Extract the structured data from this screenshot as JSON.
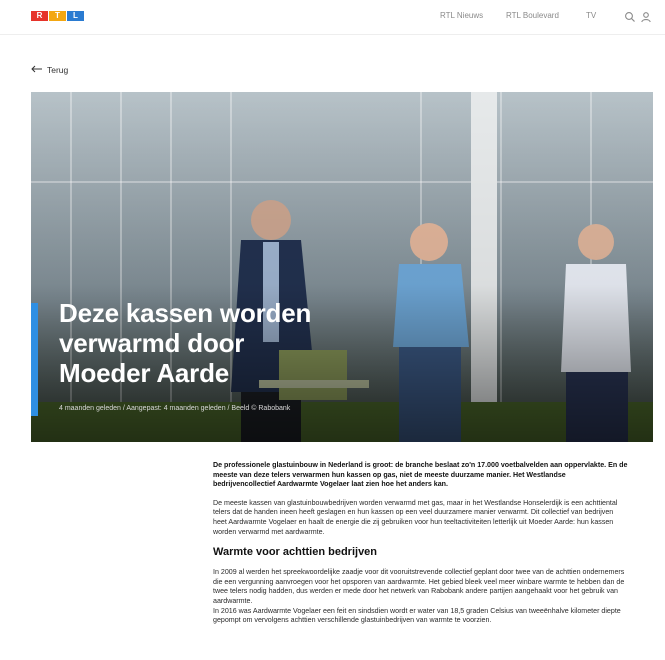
{
  "header": {
    "logo": [
      "R",
      "T",
      "L"
    ],
    "nav": [
      "RTL Nieuws",
      "RTL Boulevard",
      "TV"
    ],
    "search_icon": "search-icon",
    "user_icon": "user-icon",
    "colors": {
      "logo_red": "#e6332a",
      "logo_yellow": "#f3a712",
      "logo_blue": "#2a7bd1"
    }
  },
  "back": {
    "label": "Terug",
    "icon": "arrow-left-icon"
  },
  "hero": {
    "title_lines": [
      "Deze kassen worden",
      "verwarmd door",
      "Moeder Aarde"
    ],
    "meta": "4 maanden geleden / Aangepast: 4 maanden geleden / Beeld © Rabobank",
    "accent_color": "#2f8fe3"
  },
  "article": {
    "lead": "De professionele glastuinbouw in Nederland is groot: de branche beslaat zo'n 17.000 voetbalvelden aan oppervlakte. En de meeste van deze telers verwarmen hun kassen op gas, niet de meeste duurzame manier. Het Westlandse bedrijvencollectief Aardwarmte Vogelaer laat zien hoe het anders kan.",
    "p1": "De meeste kassen van glastuinbouwbedrijven worden verwarmd met gas, maar in het Westlandse Honselerdijk is een achttiental telers dat de handen ineen heeft geslagen en hun kassen op een veel duurzamere manier verwarmt. Dit collectief van bedrijven heet Aardwarmte Vogelaer en haalt de energie die zij gebruiken voor hun teeltactiviteiten letterlijk uit Moeder Aarde: hun kassen worden verwarmd met aardwarmte.",
    "heading": "Warmte voor achttien bedrijven",
    "p2": "In 2009 al werden het spreekwoordelijke zaadje voor dit vooruitstrevende collectief geplant door twee van de achttien ondernemers die een vergunning aanvroegen voor het opsporen van aardwarmte. Het gebied bleek veel meer winbare warmte te hebben dan de twee telers nodig hadden, dus werden er mede door het netwerk van Rabobank andere partijen aangehaakt voor het gebruik van aardwarmte.",
    "p3": "In 2016 was Aardwarmte Vogelaer een feit en sindsdien wordt er water van 18,5 graden Celsius van tweeënhalve kilometer diepte gepompt om vervolgens achttien verschillende glastuinbedrijven van warmte te voorzien."
  }
}
